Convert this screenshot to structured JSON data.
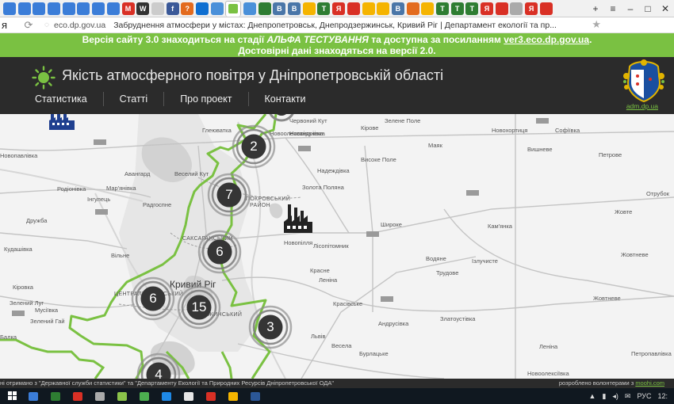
{
  "browser": {
    "tabs": [
      {
        "glyph": "",
        "color": "#3b7dd8"
      },
      {
        "glyph": "",
        "color": "#3b7dd8"
      },
      {
        "glyph": "",
        "color": "#3b7dd8"
      },
      {
        "glyph": "",
        "color": "#3b7dd8"
      },
      {
        "glyph": "",
        "color": "#3b7dd8"
      },
      {
        "glyph": "",
        "color": "#3b7dd8"
      },
      {
        "glyph": "",
        "color": "#3b7dd8"
      },
      {
        "glyph": "",
        "color": "#3b7dd8"
      },
      {
        "glyph": "M",
        "color": "#d93025"
      },
      {
        "glyph": "W",
        "color": "#333333"
      },
      {
        "glyph": "",
        "color": "#cccccc"
      },
      {
        "glyph": "f",
        "color": "#3b5998"
      },
      {
        "glyph": "?",
        "color": "#e36b1e"
      },
      {
        "glyph": "",
        "color": "#0f6fd1"
      },
      {
        "glyph": "",
        "color": "#4a90d9"
      },
      {
        "glyph": "",
        "color": "#7ac142",
        "active": true
      },
      {
        "glyph": "",
        "color": "#4a90d9"
      },
      {
        "glyph": "",
        "color": "#2e7d32"
      },
      {
        "glyph": "B",
        "color": "#4a76a8"
      },
      {
        "glyph": "B",
        "color": "#4a76a8"
      },
      {
        "glyph": "",
        "color": "#f5b400"
      },
      {
        "glyph": "T",
        "color": "#2e7d32"
      },
      {
        "glyph": "Я",
        "color": "#d93025"
      },
      {
        "glyph": "",
        "color": "#d93025"
      },
      {
        "glyph": "",
        "color": "#f5b400"
      },
      {
        "glyph": "",
        "color": "#f5b400"
      },
      {
        "glyph": "B",
        "color": "#4a76a8"
      },
      {
        "glyph": "",
        "color": "#e36b1e"
      },
      {
        "glyph": "",
        "color": "#f5b400"
      },
      {
        "glyph": "T",
        "color": "#2e7d32"
      },
      {
        "glyph": "T",
        "color": "#2e7d32"
      },
      {
        "glyph": "T",
        "color": "#2e7d32"
      },
      {
        "glyph": "Я",
        "color": "#d93025"
      },
      {
        "glyph": "",
        "color": "#d93025"
      },
      {
        "glyph": "",
        "color": "#aaaaaa"
      },
      {
        "glyph": "Я",
        "color": "#d93025"
      },
      {
        "glyph": "",
        "color": "#d93025"
      }
    ],
    "window_controls": [
      "+",
      "≡",
      "–",
      "□",
      "✕"
    ],
    "address": {
      "cut_char": "я",
      "url": "eco.dp.gov.ua",
      "title": "Забруднення атмосфери у містах: Днепропетровськ, Днепродзержинськ, Кривий Ріг | Департамент екології та пр..."
    }
  },
  "banner": {
    "line1_a": "Версія сайту 3.0 знаходиться на стадії ",
    "line1_em": "АЛЬФА ТЕСТУВАННЯ",
    "line1_b": " та доступна за посиланням ",
    "line1_link": "ver3.eco.dp.gov.ua",
    "line1_end": ".",
    "line2": "Достовірні дані знаходяться на версії 2.0."
  },
  "header": {
    "title": "Якість атмосферного повітря у Дніпропетровській області",
    "nav": [
      "Статистика",
      "Статті",
      "Про проект",
      "Контакти"
    ],
    "crest_link": "adm.dp.ua"
  },
  "map": {
    "clusters": [
      "2",
      "7",
      "6",
      "6",
      "15",
      "3",
      "4"
    ],
    "places": [
      "Новопавлівка",
      "Глеюватка",
      "Новоолександрівка",
      "Авангард",
      "Веселий Кут",
      "Родіонівка",
      "Мар'янівка",
      "Інгулець",
      "Радгоспне",
      "Дружба",
      "Кудашівка",
      "Вільне",
      "Кіровка",
      "Зелений Луг",
      "Мусіївка",
      "Зелений Гай",
      "Балка",
      "Червоний Кут",
      "Новоіванівка",
      "Кірове",
      "Зелене Поле",
      "Новохортиця",
      "Софіївка",
      "Маяк",
      "Вишневе",
      "Високе Поле",
      "Петрове",
      "Надеждівка",
      "Золота Поляна",
      "Отрубок",
      "Жовте",
      "Широке",
      "Кам'янка",
      "Лісопітомник",
      "Водяне",
      "Ізлучисте",
      "Трудове",
      "Красне",
      "Леніна",
      "Красівське",
      "Жовтневе",
      "Андрусівка",
      "Златоустівка",
      "Весела",
      "Львів",
      "Леніна",
      "Петропавлівка",
      "Бурлацьке",
      "Новоолексіївка",
      "Жовтневе",
      "Новопілля"
    ],
    "city": "Кривий Ріг",
    "districts": [
      "ПОКРОВСЬКИЙ",
      "РАЙОН",
      "САКСАГАНСЬКИЙ",
      "ЦЕНТРАЛЬНО-МІСЬКИЙ",
      "ДЗЕРЖИНСЬКИЙ"
    ]
  },
  "footer": {
    "left": "ні отримано з \"Державної служби статистики\" та \"Департаменту Екології та Природних Ресурсів Дніпропетровської ОДА\"",
    "right_text": "розроблено волонтерами з ",
    "right_link": "moohi.com"
  },
  "taskbar": {
    "apps": [
      "#3b7dd8",
      "#2e7d32",
      "#d93025",
      "#aaaaaa",
      "#8bc34a",
      "#4caf50",
      "#1e88e5",
      "#e6e6e6",
      "#d93025",
      "#f5b400",
      "#2b5797"
    ],
    "tray_icons": [
      "▲",
      "▮",
      "◂)",
      "✉"
    ],
    "lang": "РУС",
    "clock": "12:"
  }
}
